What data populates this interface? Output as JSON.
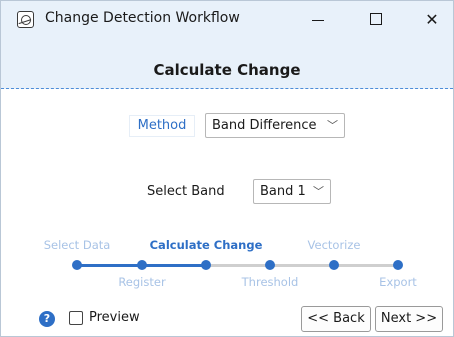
{
  "window": {
    "title": "Change Detection Workflow"
  },
  "step": {
    "title": "Calculate Change"
  },
  "method": {
    "label": "Method",
    "value": "Band Difference"
  },
  "band": {
    "label": "Select Band",
    "value": "Band 1"
  },
  "progress": {
    "current_step": 2,
    "steps": [
      "Select Data",
      "Register",
      "Calculate Change",
      "Threshold",
      "Vectorize",
      "Export"
    ],
    "colors": {
      "done": "#2e6fc6",
      "todo": "#cfcfcf"
    }
  },
  "footer": {
    "preview_label": "Preview",
    "preview_checked": false,
    "back_label": "<< Back",
    "next_label": "Next >>"
  },
  "icons": {
    "app": "change-detection-app-icon",
    "help": "help-icon",
    "dropdown": "chevron-down-icon"
  }
}
